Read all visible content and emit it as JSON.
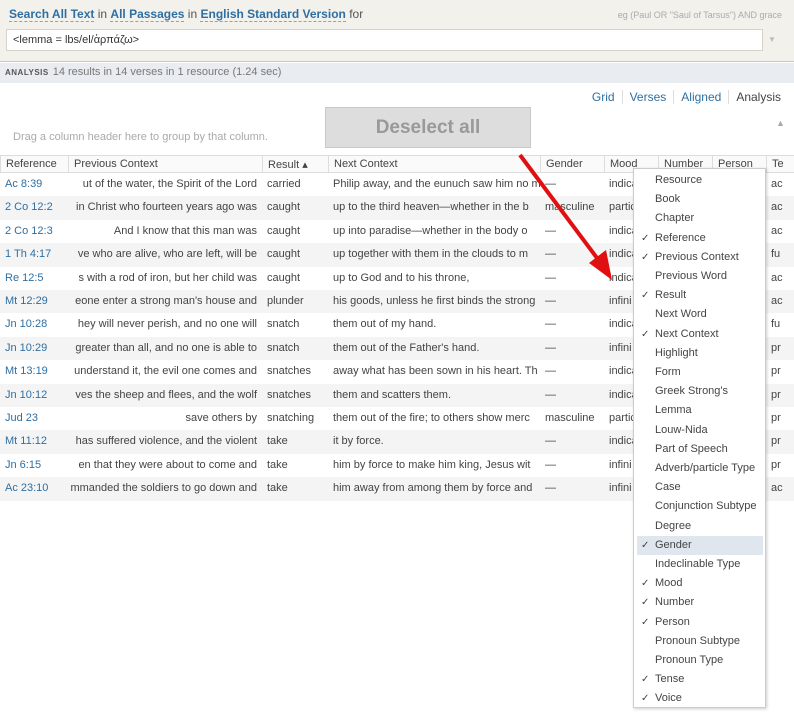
{
  "search": {
    "scope_label": "Search All Text",
    "in1": "in",
    "passages": "All Passages",
    "in2": "in",
    "version": "English Standard Version",
    "for": "for",
    "hint": "eg (Paul OR \"Saul of Tarsus\") AND grace",
    "query": "<lemma = lbs/el/ἁρπάζω>"
  },
  "analysis": {
    "label": "ANALYSIS",
    "summary": "14 results in 14 verses in 1 resource (1.24 sec)"
  },
  "views": [
    "Grid",
    "Verses",
    "Aligned",
    "Analysis"
  ],
  "drag_hint": "Drag a column header here to group by that column.",
  "deselect_label": "Deselect all",
  "columns": [
    "Reference",
    "Previous Context",
    "Result ▴",
    "Next Context",
    "Gender",
    "Mood",
    "Number",
    "Person",
    "Te"
  ],
  "rows": [
    [
      "Ac 8:39",
      "ut of the water, the Spirit of the Lord",
      "carried",
      "Philip away, and the eunuch saw him no m",
      "—",
      "indica",
      "ac"
    ],
    [
      "2 Co 12:2",
      "in Christ who fourteen years ago was",
      "caught",
      "up to the third heaven—whether in the b",
      "masculine",
      "partic",
      "ac"
    ],
    [
      "2 Co 12:3",
      "And I know that this man was",
      "caught",
      "up into paradise—whether in the body o",
      "—",
      "indica",
      "ac"
    ],
    [
      "1 Th 4:17",
      "ve who are alive, who are left, will be",
      "caught",
      "up together with them in the clouds to m",
      "—",
      "indica",
      "fu"
    ],
    [
      "Re 12:5",
      "s with a rod of iron, but her child was",
      "caught",
      "up to God and to his throne,",
      "—",
      "indica",
      "ac"
    ],
    [
      "Mt 12:29",
      "eone enter a strong man's house and",
      "plunder",
      "his goods, unless he first binds the strong",
      "—",
      "infini",
      "ac"
    ],
    [
      "Jn 10:28",
      "hey will never perish, and no one will",
      "snatch",
      "them out of my hand.",
      "—",
      "indica",
      "fu"
    ],
    [
      "Jn 10:29",
      "greater than all, and no one is able to",
      "snatch",
      "them out of the Father's hand.",
      "—",
      "infini",
      "pr"
    ],
    [
      "Mt 13:19",
      "understand it, the evil one comes and",
      "snatches",
      "away what has been sown in his heart. Th",
      "—",
      "indica",
      "pr"
    ],
    [
      "Jn 10:12",
      "ves the sheep and flees, and the wolf",
      "snatches",
      "them and scatters them.",
      "—",
      "indica",
      "pr"
    ],
    [
      "Jud 23",
      "save others by",
      "snatching",
      "them out of the fire; to others show merc",
      "masculine",
      "partic",
      "pr"
    ],
    [
      "Mt 11:12",
      "has suffered violence, and the violent",
      "take",
      "it by force.",
      "—",
      "indica",
      "pr"
    ],
    [
      "Jn 6:15",
      "en that they were about to come and",
      "take",
      "him by force to make him king, Jesus wit",
      "—",
      "infini",
      "pr"
    ],
    [
      "Ac 23:10",
      "mmanded the soldiers to go down and",
      "take",
      "him away from among them by force and",
      "—",
      "infini",
      "ac"
    ]
  ],
  "menu": [
    {
      "label": "Resource",
      "checked": false
    },
    {
      "label": "Book",
      "checked": false
    },
    {
      "label": "Chapter",
      "checked": false
    },
    {
      "label": "Reference",
      "checked": true
    },
    {
      "label": "Previous Context",
      "checked": true
    },
    {
      "label": "Previous Word",
      "checked": false
    },
    {
      "label": "Result",
      "checked": true
    },
    {
      "label": "Next Word",
      "checked": false
    },
    {
      "label": "Next Context",
      "checked": true
    },
    {
      "label": "Highlight",
      "checked": false
    },
    {
      "label": "Form",
      "checked": false
    },
    {
      "label": "Greek Strong's",
      "checked": false
    },
    {
      "label": "Lemma",
      "checked": false
    },
    {
      "label": "Louw-Nida",
      "checked": false
    },
    {
      "label": "Part of Speech",
      "checked": false
    },
    {
      "label": "Adverb/particle Type",
      "checked": false
    },
    {
      "label": "Case",
      "checked": false
    },
    {
      "label": "Conjunction Subtype",
      "checked": false
    },
    {
      "label": "Degree",
      "checked": false
    },
    {
      "label": "Gender",
      "checked": true,
      "highlighted": true
    },
    {
      "label": "Indeclinable Type",
      "checked": false
    },
    {
      "label": "Mood",
      "checked": true
    },
    {
      "label": "Number",
      "checked": true
    },
    {
      "label": "Person",
      "checked": true
    },
    {
      "label": "Pronoun Subtype",
      "checked": false
    },
    {
      "label": "Pronoun Type",
      "checked": false
    },
    {
      "label": "Tense",
      "checked": true
    },
    {
      "label": "Voice",
      "checked": true
    }
  ],
  "check_glyph": "✓",
  "colors": {
    "link": "#2e6fa3",
    "arrow": "#e01010"
  }
}
